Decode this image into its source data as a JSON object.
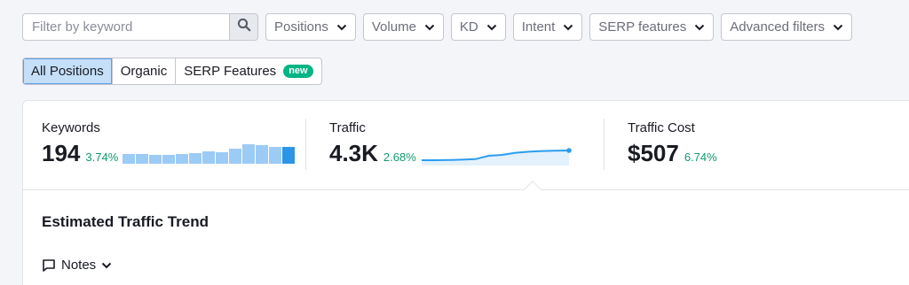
{
  "filters": {
    "search_placeholder": "Filter by keyword",
    "dropdowns": [
      "Positions",
      "Volume",
      "KD",
      "Intent",
      "SERP features",
      "Advanced filters"
    ]
  },
  "tabs": [
    {
      "label": "All Positions",
      "active": true
    },
    {
      "label": "Organic",
      "active": false
    },
    {
      "label": "SERP Features",
      "active": false,
      "badge": "new"
    }
  ],
  "metrics": {
    "keywords": {
      "label": "Keywords",
      "value": "194",
      "change": "3.74%",
      "bars": [
        0.45,
        0.45,
        0.42,
        0.42,
        0.45,
        0.5,
        0.58,
        0.55,
        0.72,
        0.92,
        0.88,
        0.8,
        0.8
      ],
      "bar_color": "#9ccbf6",
      "bar_last_color": "#2c95e8"
    },
    "traffic": {
      "label": "Traffic",
      "value": "4.3K",
      "change": "2.68%",
      "sparkline": [
        0.2,
        0.2,
        0.21,
        0.23,
        0.26,
        0.45,
        0.5,
        0.62,
        0.68,
        0.72,
        0.74,
        0.75
      ],
      "line_color": "#2c9cf0",
      "fill_color": "#e3f1fd"
    },
    "traffic_cost": {
      "label": "Traffic Cost",
      "value": "$507",
      "change": "6.74%"
    }
  },
  "section": {
    "title": "Estimated Traffic Trend",
    "notes_label": "Notes"
  },
  "colors": {
    "positive": "#0f9b6c",
    "active_tab_bg": "#c5dff8",
    "badge_bg": "#00b484"
  },
  "icons": {
    "search": "search-icon",
    "chevron": "chevron-down-icon",
    "notes": "comment-icon"
  }
}
